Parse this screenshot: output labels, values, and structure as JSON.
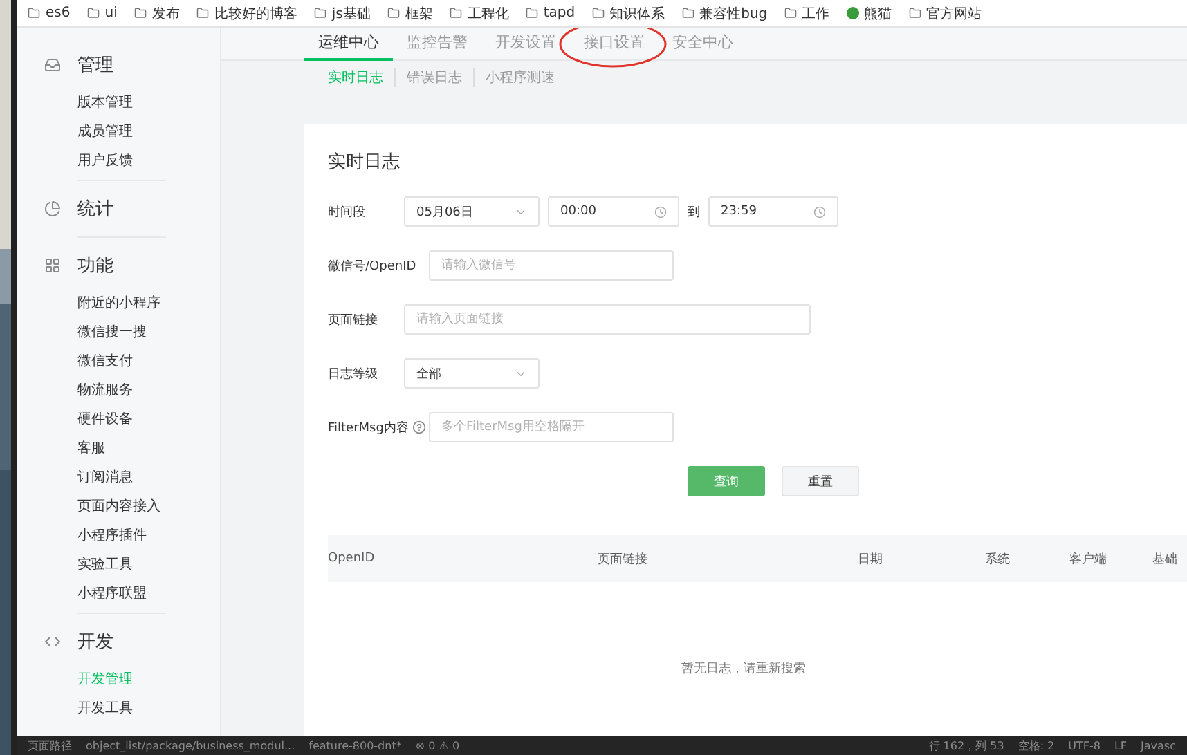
{
  "bookmarks": [
    {
      "label": "es6",
      "kind": "folder"
    },
    {
      "label": "ui",
      "kind": "folder"
    },
    {
      "label": "发布",
      "kind": "folder"
    },
    {
      "label": "比较好的博客",
      "kind": "folder"
    },
    {
      "label": "js基础",
      "kind": "folder"
    },
    {
      "label": "框架",
      "kind": "folder"
    },
    {
      "label": "工程化",
      "kind": "folder"
    },
    {
      "label": "tapd",
      "kind": "folder"
    },
    {
      "label": "知识体系",
      "kind": "folder"
    },
    {
      "label": "兼容性bug",
      "kind": "folder"
    },
    {
      "label": "工作",
      "kind": "folder"
    },
    {
      "label": "熊猫",
      "kind": "site"
    },
    {
      "label": "官方网站",
      "kind": "folder"
    }
  ],
  "sidebar": [
    {
      "title": "管理",
      "items": [
        {
          "label": "版本管理",
          "selected": false
        },
        {
          "label": "成员管理",
          "selected": false
        },
        {
          "label": "用户反馈",
          "selected": false
        }
      ]
    },
    {
      "title": "统计"
    },
    {
      "title": "功能",
      "items": [
        {
          "label": "附近的小程序",
          "selected": false
        },
        {
          "label": "微信搜一搜",
          "selected": false
        },
        {
          "label": "微信支付",
          "selected": false
        },
        {
          "label": "物流服务",
          "selected": false
        },
        {
          "label": "硬件设备",
          "selected": false
        },
        {
          "label": "客服",
          "selected": false
        },
        {
          "label": "订阅消息",
          "selected": false
        },
        {
          "label": "页面内容接入",
          "selected": false
        },
        {
          "label": "小程序插件",
          "selected": false
        },
        {
          "label": "实验工具",
          "selected": false
        },
        {
          "label": "小程序联盟",
          "selected": false
        }
      ]
    },
    {
      "title": "开发",
      "items": [
        {
          "label": "开发管理",
          "selected": true
        },
        {
          "label": "开发工具",
          "selected": false
        }
      ]
    }
  ],
  "tabs": [
    {
      "label": "运维中心",
      "selected": true
    },
    {
      "label": "监控告警",
      "selected": false
    },
    {
      "label": "开发设置",
      "selected": false
    },
    {
      "label": "接口设置",
      "selected": false,
      "circled": true
    },
    {
      "label": "安全中心",
      "selected": false
    }
  ],
  "subtabs": [
    {
      "label": "实时日志",
      "selected": true
    },
    {
      "label": "错误日志",
      "selected": false
    },
    {
      "label": "小程序测速",
      "selected": false
    }
  ],
  "card": {
    "title": "实时日志",
    "time_range": {
      "label": "时间段",
      "date": "05月06日",
      "start": "00:00",
      "to": "到",
      "end": "23:59"
    },
    "openid": {
      "label": "微信号/OpenID",
      "placeholder": "请输入微信号"
    },
    "page_link": {
      "label": "页面链接",
      "placeholder": "请输入页面链接"
    },
    "level": {
      "label": "日志等级",
      "value": "全部"
    },
    "filter": {
      "label": "FilterMsg内容",
      "placeholder": "多个FilterMsg用空格隔开"
    },
    "buttons": [
      {
        "label": "查询",
        "kind": "primary"
      },
      {
        "label": "重置",
        "kind": "default"
      }
    ],
    "table": {
      "columns": [
        "OpenID",
        "页面链接",
        "日期",
        "系统",
        "客户端",
        "基础"
      ],
      "empty": "暂无日志，请重新搜索"
    }
  },
  "status_bar": {
    "left": [
      "页面路径",
      "object_list/package/business_modul...",
      "feature-800-dnt*",
      "⊗ 0 ⚠ 0"
    ],
    "right": [
      "行 162，列 53",
      "空格: 2",
      "UTF-8",
      "LF",
      "Javasc"
    ]
  }
}
